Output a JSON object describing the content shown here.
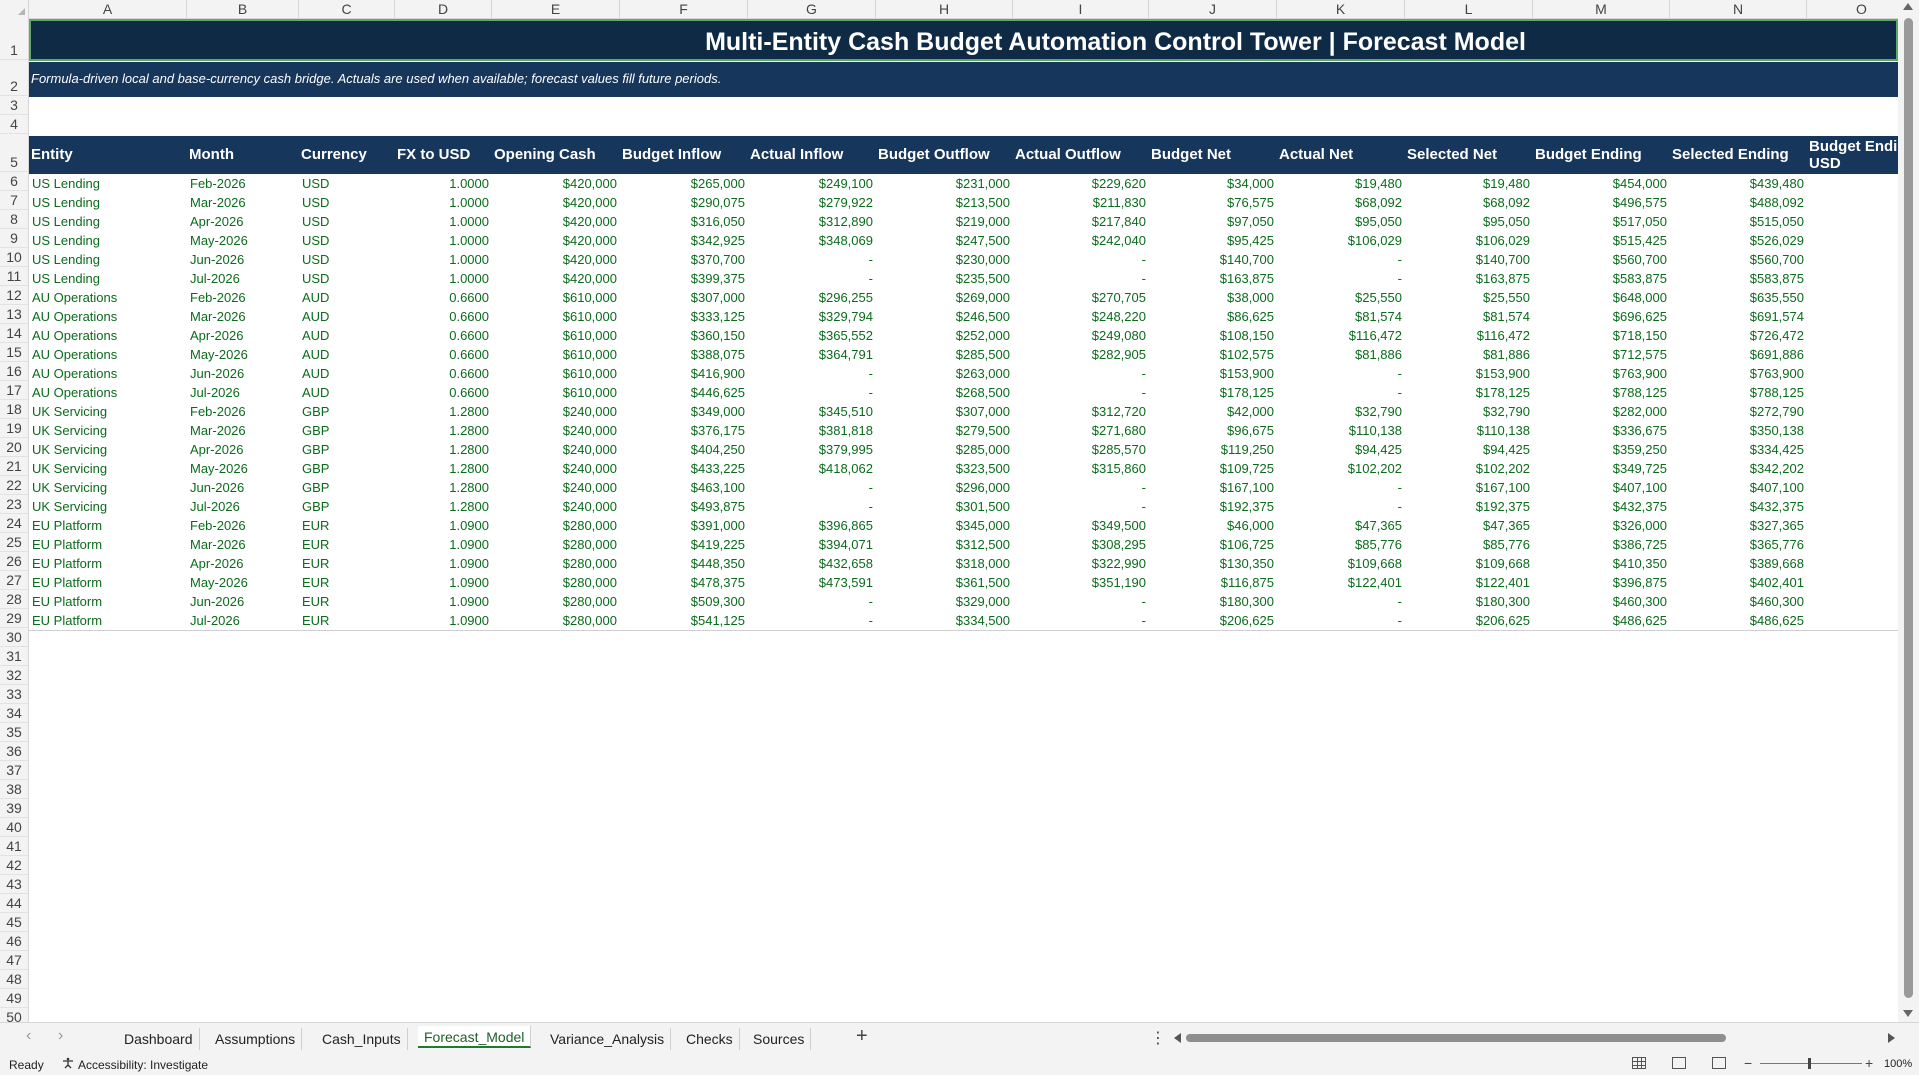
{
  "columns": [
    "A",
    "B",
    "C",
    "D",
    "E",
    "F",
    "G",
    "H",
    "I",
    "J",
    "K",
    "L",
    "M",
    "N",
    "O"
  ],
  "row_numbers": [
    "1",
    "2",
    "3",
    "4",
    "5",
    "6",
    "7",
    "8",
    "9",
    "10",
    "11",
    "12",
    "13",
    "14",
    "15",
    "16",
    "17",
    "18",
    "19",
    "20",
    "21",
    "22",
    "23",
    "24",
    "25",
    "26",
    "27",
    "28",
    "29",
    "30",
    "31",
    "32",
    "33",
    "34",
    "35",
    "36",
    "37",
    "38",
    "39",
    "40",
    "41",
    "42",
    "43",
    "44",
    "45",
    "46",
    "47",
    "48",
    "49",
    "50"
  ],
  "title": "Multi-Entity Cash Budget Automation Control Tower | Forecast Model",
  "subtitle": "Formula-driven local and base-currency cash bridge. Actuals are used when available; forecast values fill future periods.",
  "headers": [
    "Entity",
    "Month",
    "Currency",
    "FX to USD",
    "Opening Cash",
    "Budget Inflow",
    "Actual Inflow",
    "Budget Outflow",
    "Actual Outflow",
    "Budget Net",
    "Actual Net",
    "Selected Net",
    "Budget Ending",
    "Selected Ending",
    "Budget Ending USD"
  ],
  "rows": [
    [
      "US Lending",
      "Feb-2026",
      "USD",
      "1.0000",
      "$420,000",
      "$265,000",
      "$249,100",
      "$231,000",
      "$229,620",
      "$34,000",
      "$19,480",
      "$19,480",
      "$454,000",
      "$439,480",
      "$"
    ],
    [
      "US Lending",
      "Mar-2026",
      "USD",
      "1.0000",
      "$420,000",
      "$290,075",
      "$279,922",
      "$213,500",
      "$211,830",
      "$76,575",
      "$68,092",
      "$68,092",
      "$496,575",
      "$488,092",
      "$"
    ],
    [
      "US Lending",
      "Apr-2026",
      "USD",
      "1.0000",
      "$420,000",
      "$316,050",
      "$312,890",
      "$219,000",
      "$217,840",
      "$97,050",
      "$95,050",
      "$95,050",
      "$517,050",
      "$515,050",
      "$"
    ],
    [
      "US Lending",
      "May-2026",
      "USD",
      "1.0000",
      "$420,000",
      "$342,925",
      "$348,069",
      "$247,500",
      "$242,040",
      "$95,425",
      "$106,029",
      "$106,029",
      "$515,425",
      "$526,029",
      "$"
    ],
    [
      "US Lending",
      "Jun-2026",
      "USD",
      "1.0000",
      "$420,000",
      "$370,700",
      "-",
      "$230,000",
      "-",
      "$140,700",
      "-",
      "$140,700",
      "$560,700",
      "$560,700",
      "$"
    ],
    [
      "US Lending",
      "Jul-2026",
      "USD",
      "1.0000",
      "$420,000",
      "$399,375",
      "-",
      "$235,500",
      "-",
      "$163,875",
      "-",
      "$163,875",
      "$583,875",
      "$583,875",
      "$"
    ],
    [
      "AU Operations",
      "Feb-2026",
      "AUD",
      "0.6600",
      "$610,000",
      "$307,000",
      "$296,255",
      "$269,000",
      "$270,705",
      "$38,000",
      "$25,550",
      "$25,550",
      "$648,000",
      "$635,550",
      "$"
    ],
    [
      "AU Operations",
      "Mar-2026",
      "AUD",
      "0.6600",
      "$610,000",
      "$333,125",
      "$329,794",
      "$246,500",
      "$248,220",
      "$86,625",
      "$81,574",
      "$81,574",
      "$696,625",
      "$691,574",
      "$"
    ],
    [
      "AU Operations",
      "Apr-2026",
      "AUD",
      "0.6600",
      "$610,000",
      "$360,150",
      "$365,552",
      "$252,000",
      "$249,080",
      "$108,150",
      "$116,472",
      "$116,472",
      "$718,150",
      "$726,472",
      "$"
    ],
    [
      "AU Operations",
      "May-2026",
      "AUD",
      "0.6600",
      "$610,000",
      "$388,075",
      "$364,791",
      "$285,500",
      "$282,905",
      "$102,575",
      "$81,886",
      "$81,886",
      "$712,575",
      "$691,886",
      "$"
    ],
    [
      "AU Operations",
      "Jun-2026",
      "AUD",
      "0.6600",
      "$610,000",
      "$416,900",
      "-",
      "$263,000",
      "-",
      "$153,900",
      "-",
      "$153,900",
      "$763,900",
      "$763,900",
      "$"
    ],
    [
      "AU Operations",
      "Jul-2026",
      "AUD",
      "0.6600",
      "$610,000",
      "$446,625",
      "-",
      "$268,500",
      "-",
      "$178,125",
      "-",
      "$178,125",
      "$788,125",
      "$788,125",
      "$"
    ],
    [
      "UK Servicing",
      "Feb-2026",
      "GBP",
      "1.2800",
      "$240,000",
      "$349,000",
      "$345,510",
      "$307,000",
      "$312,720",
      "$42,000",
      "$32,790",
      "$32,790",
      "$282,000",
      "$272,790",
      "$"
    ],
    [
      "UK Servicing",
      "Mar-2026",
      "GBP",
      "1.2800",
      "$240,000",
      "$376,175",
      "$381,818",
      "$279,500",
      "$271,680",
      "$96,675",
      "$110,138",
      "$110,138",
      "$336,675",
      "$350,138",
      "$"
    ],
    [
      "UK Servicing",
      "Apr-2026",
      "GBP",
      "1.2800",
      "$240,000",
      "$404,250",
      "$379,995",
      "$285,000",
      "$285,570",
      "$119,250",
      "$94,425",
      "$94,425",
      "$359,250",
      "$334,425",
      "$"
    ],
    [
      "UK Servicing",
      "May-2026",
      "GBP",
      "1.2800",
      "$240,000",
      "$433,225",
      "$418,062",
      "$323,500",
      "$315,860",
      "$109,725",
      "$102,202",
      "$102,202",
      "$349,725",
      "$342,202",
      "$"
    ],
    [
      "UK Servicing",
      "Jun-2026",
      "GBP",
      "1.2800",
      "$240,000",
      "$463,100",
      "-",
      "$296,000",
      "-",
      "$167,100",
      "-",
      "$167,100",
      "$407,100",
      "$407,100",
      "$"
    ],
    [
      "UK Servicing",
      "Jul-2026",
      "GBP",
      "1.2800",
      "$240,000",
      "$493,875",
      "-",
      "$301,500",
      "-",
      "$192,375",
      "-",
      "$192,375",
      "$432,375",
      "$432,375",
      "$"
    ],
    [
      "EU Platform",
      "Feb-2026",
      "EUR",
      "1.0900",
      "$280,000",
      "$391,000",
      "$396,865",
      "$345,000",
      "$349,500",
      "$46,000",
      "$47,365",
      "$47,365",
      "$326,000",
      "$327,365",
      "$"
    ],
    [
      "EU Platform",
      "Mar-2026",
      "EUR",
      "1.0900",
      "$280,000",
      "$419,225",
      "$394,071",
      "$312,500",
      "$308,295",
      "$106,725",
      "$85,776",
      "$85,776",
      "$386,725",
      "$365,776",
      "$"
    ],
    [
      "EU Platform",
      "Apr-2026",
      "EUR",
      "1.0900",
      "$280,000",
      "$448,350",
      "$432,658",
      "$318,000",
      "$322,990",
      "$130,350",
      "$109,668",
      "$109,668",
      "$410,350",
      "$389,668",
      "$"
    ],
    [
      "EU Platform",
      "May-2026",
      "EUR",
      "1.0900",
      "$280,000",
      "$478,375",
      "$473,591",
      "$361,500",
      "$351,190",
      "$116,875",
      "$122,401",
      "$122,401",
      "$396,875",
      "$402,401",
      "$"
    ],
    [
      "EU Platform",
      "Jun-2026",
      "EUR",
      "1.0900",
      "$280,000",
      "$509,300",
      "-",
      "$329,000",
      "-",
      "$180,300",
      "-",
      "$180,300",
      "$460,300",
      "$460,300",
      "$"
    ],
    [
      "EU Platform",
      "Jul-2026",
      "EUR",
      "1.0900",
      "$280,000",
      "$541,125",
      "-",
      "$334,500",
      "-",
      "$206,625",
      "-",
      "$206,625",
      "$486,625",
      "$486,625",
      "$"
    ]
  ],
  "sheet_tabs": [
    "Dashboard",
    "Assumptions",
    "Cash_Inputs",
    "Forecast_Model",
    "Variance_Analysis",
    "Checks",
    "Sources"
  ],
  "active_tab": "Forecast_Model",
  "status": {
    "ready": "Ready",
    "accessibility": "Accessibility: Investigate",
    "zoom": "100%"
  },
  "icons": {
    "add_sheet": "plus-icon",
    "more": "vertical-ellipsis-icon",
    "accessibility": "accessibility-icon"
  },
  "colors": {
    "header_band": "#16365c",
    "title_band": "#0f2a45",
    "data_text": "#0b6b1c",
    "active_tab": "#1e7a32"
  }
}
